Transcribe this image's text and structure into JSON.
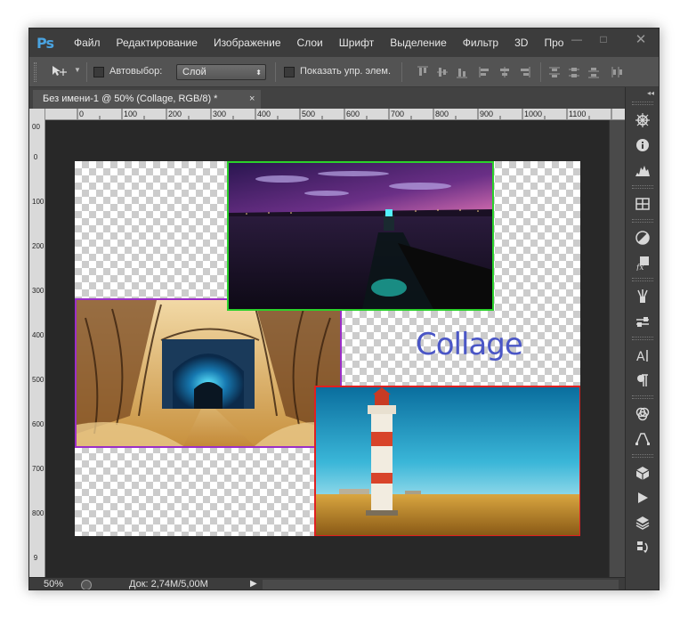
{
  "app": {
    "logo": "Ps"
  },
  "menu": [
    "Файл",
    "Редактирование",
    "Изображение",
    "Слои",
    "Шрифт",
    "Выделение",
    "Фильтр",
    "3D",
    "Про"
  ],
  "window_controls": {
    "minimize": "—",
    "maximize": "□",
    "close": "✕"
  },
  "options_bar": {
    "auto_select_label": "Автовыбор:",
    "auto_select_value": "Слой",
    "show_transform_label": "Показать упр. элем."
  },
  "document": {
    "tab_title": "Без имени-1 @ 50% (Collage, RGB/8) *",
    "tab_close": "×",
    "text_layer": "Collage"
  },
  "ruler": {
    "horizontal": [
      "0",
      "100",
      "200",
      "300",
      "400",
      "500",
      "600",
      "700",
      "800",
      "900",
      "1000",
      "1100"
    ],
    "vertical": [
      "00",
      "0",
      "100",
      "200",
      "300",
      "400",
      "500",
      "600",
      "700",
      "800",
      "9"
    ]
  },
  "status": {
    "zoom": "50%",
    "doc_info": "Док: 2,74M/5,00M",
    "arrow": "▶"
  },
  "dock_icons": [
    "navigator-icon",
    "info-icon",
    "histogram-icon",
    "swatches-icon",
    "adjustments-icon",
    "styles-icon",
    "brushes-icon",
    "tool-presets-icon",
    "character-icon",
    "paragraph-icon",
    "channels-icon",
    "paths-icon",
    "3d-icon",
    "actions-icon",
    "layers-icon",
    "history-icon"
  ],
  "colors": {
    "frame_night": "#2bd12b",
    "frame_tunnel": "#9b2fc8",
    "frame_lighthouse": "#e02020",
    "collage_text": "#4a56c6",
    "ps_logo": "#4aa3e0"
  }
}
